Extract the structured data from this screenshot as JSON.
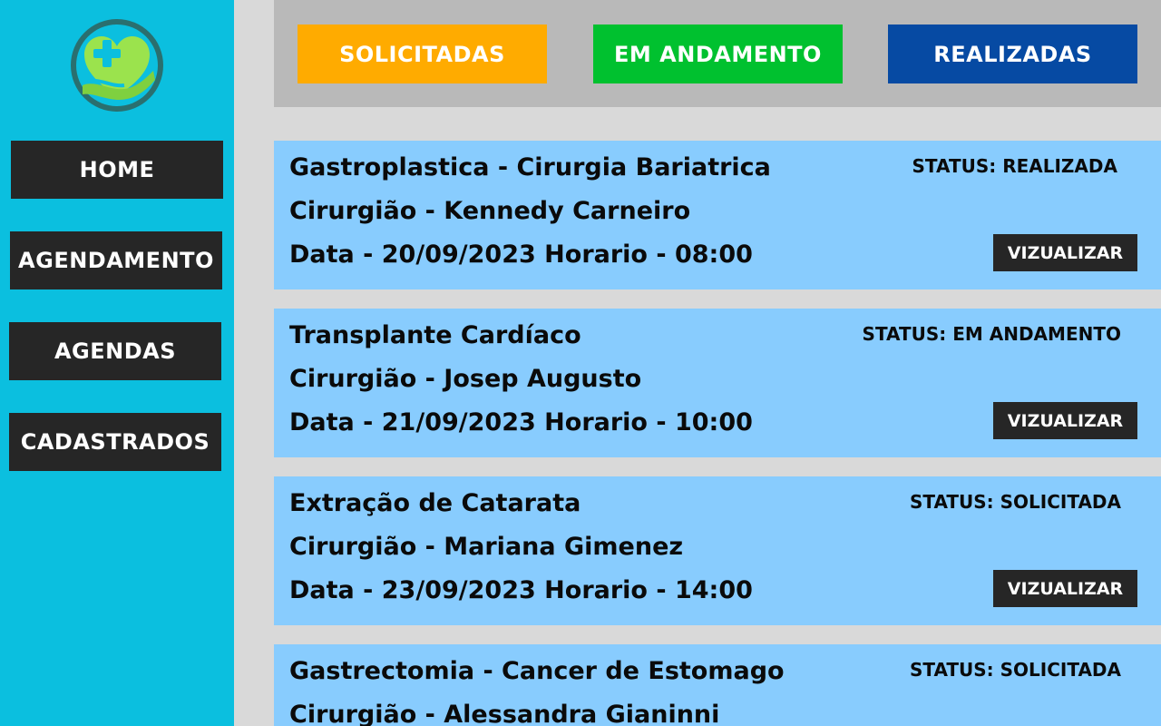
{
  "colors": {
    "sidebar": "#0bbfdf",
    "nav_button": "#262626",
    "topbar": "#b9b9b9",
    "solicitadas": "#ffab00",
    "em_andamento": "#00c12f",
    "realizadas": "#064aa3",
    "card": "#88ccfe",
    "background": "#d9d9d9"
  },
  "sidebar": {
    "logo_icon": "heart-hand-medical-cross-logo",
    "items": [
      {
        "label": "HOME"
      },
      {
        "label": "AGENDAMENTO"
      },
      {
        "label": "AGENDAS"
      },
      {
        "label": "CADASTRADOS"
      }
    ]
  },
  "filters": [
    {
      "label": "SOLICITADAS"
    },
    {
      "label": "EM ANDAMENTO"
    },
    {
      "label": "REALIZADAS"
    }
  ],
  "cards": [
    {
      "procedure": "Gastroplastica - Cirurgia Bariatrica",
      "surgeon": "Cirurgião - Kennedy Carneiro",
      "schedule": "Data - 20/09/2023  Horario - 08:00",
      "status": "STATUS: REALIZADA",
      "button": "VIZUALIZAR"
    },
    {
      "procedure": "Transplante Cardíaco",
      "surgeon": "Cirurgião - Josep Augusto",
      "schedule": "Data - 21/09/2023  Horario - 10:00",
      "status": "STATUS: EM ANDAMENTO",
      "button": "VIZUALIZAR"
    },
    {
      "procedure": "Extração de Catarata",
      "surgeon": "Cirurgião - Mariana Gimenez",
      "schedule": "Data - 23/09/2023  Horario - 14:00",
      "status": "STATUS: SOLICITADA",
      "button": "VIZUALIZAR"
    },
    {
      "procedure": "Gastrectomia - Cancer de Estomago",
      "surgeon": "Cirurgião - Alessandra Gianinni",
      "schedule": "",
      "status": "STATUS: SOLICITADA",
      "button": ""
    }
  ]
}
